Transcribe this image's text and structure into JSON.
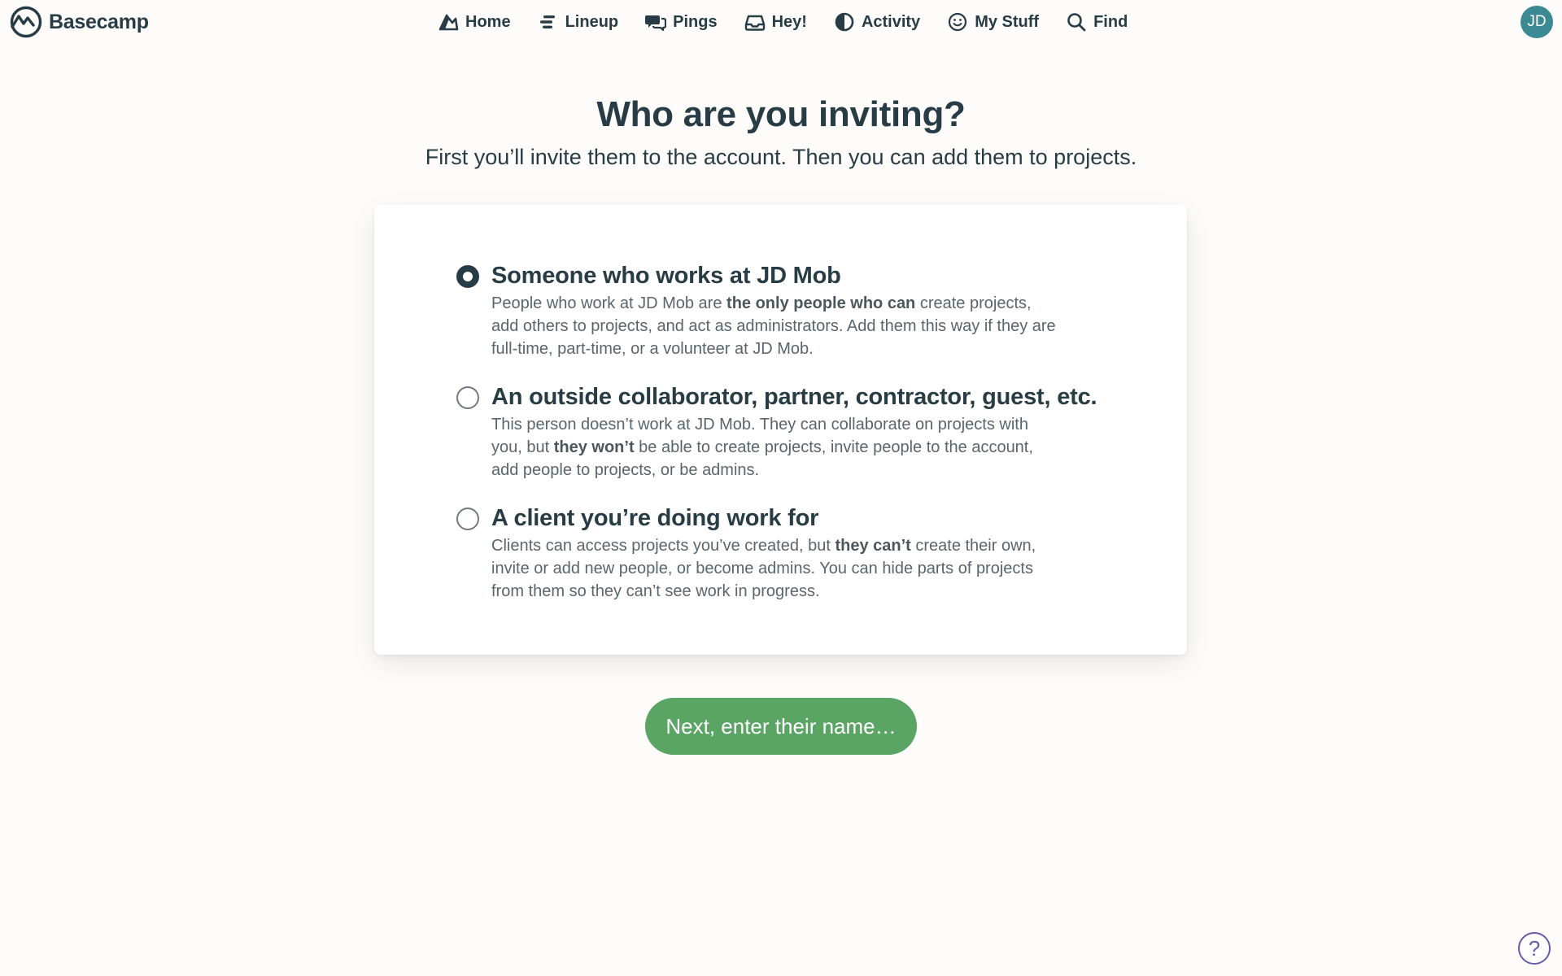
{
  "brand": {
    "name": "Basecamp",
    "color": "#283c46"
  },
  "nav": {
    "items": [
      {
        "label": "Home",
        "icon": "home-icon"
      },
      {
        "label": "Lineup",
        "icon": "lineup-icon"
      },
      {
        "label": "Pings",
        "icon": "pings-icon"
      },
      {
        "label": "Hey!",
        "icon": "hey-inbox-icon"
      },
      {
        "label": "Activity",
        "icon": "activity-icon"
      },
      {
        "label": "My Stuff",
        "icon": "smiley-icon"
      },
      {
        "label": "Find",
        "icon": "search-icon"
      }
    ]
  },
  "user": {
    "initials": "JD",
    "avatar_color": "#3b8a93"
  },
  "page": {
    "title": "Who are you inviting?",
    "subtitle": "First you’ll invite them to the account. Then you can add them to projects."
  },
  "options": [
    {
      "title": "Someone who works at JD Mob",
      "selected": true,
      "desc_before": "People who work at JD Mob are ",
      "desc_bold": "the only people who can",
      "desc_after": " create projects, add others to projects, and act as administrators. Add them this way if they are full-time, part-time, or a volunteer at JD Mob."
    },
    {
      "title": "An outside collaborator, partner, contractor, guest, etc.",
      "selected": false,
      "desc_before": "This person doesn’t work at JD Mob. They can collaborate on projects with you, but ",
      "desc_bold": "they won’t",
      "desc_after": " be able to create projects, invite people to the account, add people to projects, or be admins."
    },
    {
      "title": "A client you’re doing work for",
      "selected": false,
      "desc_before": "Clients can access projects you’ve created, but ",
      "desc_bold": "they can’t",
      "desc_after": " create their own, invite or add new people, or become admins. You can hide parts of projects from them so they can’t see work in progress."
    }
  ],
  "actions": {
    "next_label": "Next, enter their name…",
    "next_color": "#5aa564"
  },
  "help": {
    "label": "?",
    "icon": "help-icon",
    "color": "#6a5aa8"
  }
}
